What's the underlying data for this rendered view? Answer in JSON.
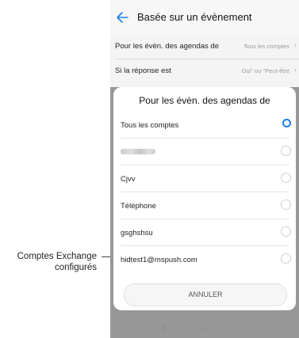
{
  "header": {
    "title": "Basée sur un évènement"
  },
  "settings": [
    {
      "label": "Pour les évèn. des agendas de",
      "value": "Tous les comptes"
    },
    {
      "label": "Si la réponse est",
      "value": "Oui\" ou \"Peut-être"
    }
  ],
  "dialog": {
    "title": "Pour les évèn. des agendas de",
    "options": [
      {
        "label": "Tous les comptes",
        "selected": true
      },
      {
        "label": "",
        "selected": false,
        "blurred": true
      },
      {
        "label": "Cjvv",
        "selected": false
      },
      {
        "label": "Téléphone",
        "selected": false
      },
      {
        "label": "gsghshsu",
        "selected": false
      },
      {
        "label": "hidtest1@mspush.com",
        "selected": false
      }
    ],
    "cancel_label": "ANNULER"
  },
  "callout": {
    "line1": "Comptes Exchange",
    "line2": "configurés"
  },
  "colors": {
    "accent": "#1e7ee8"
  }
}
